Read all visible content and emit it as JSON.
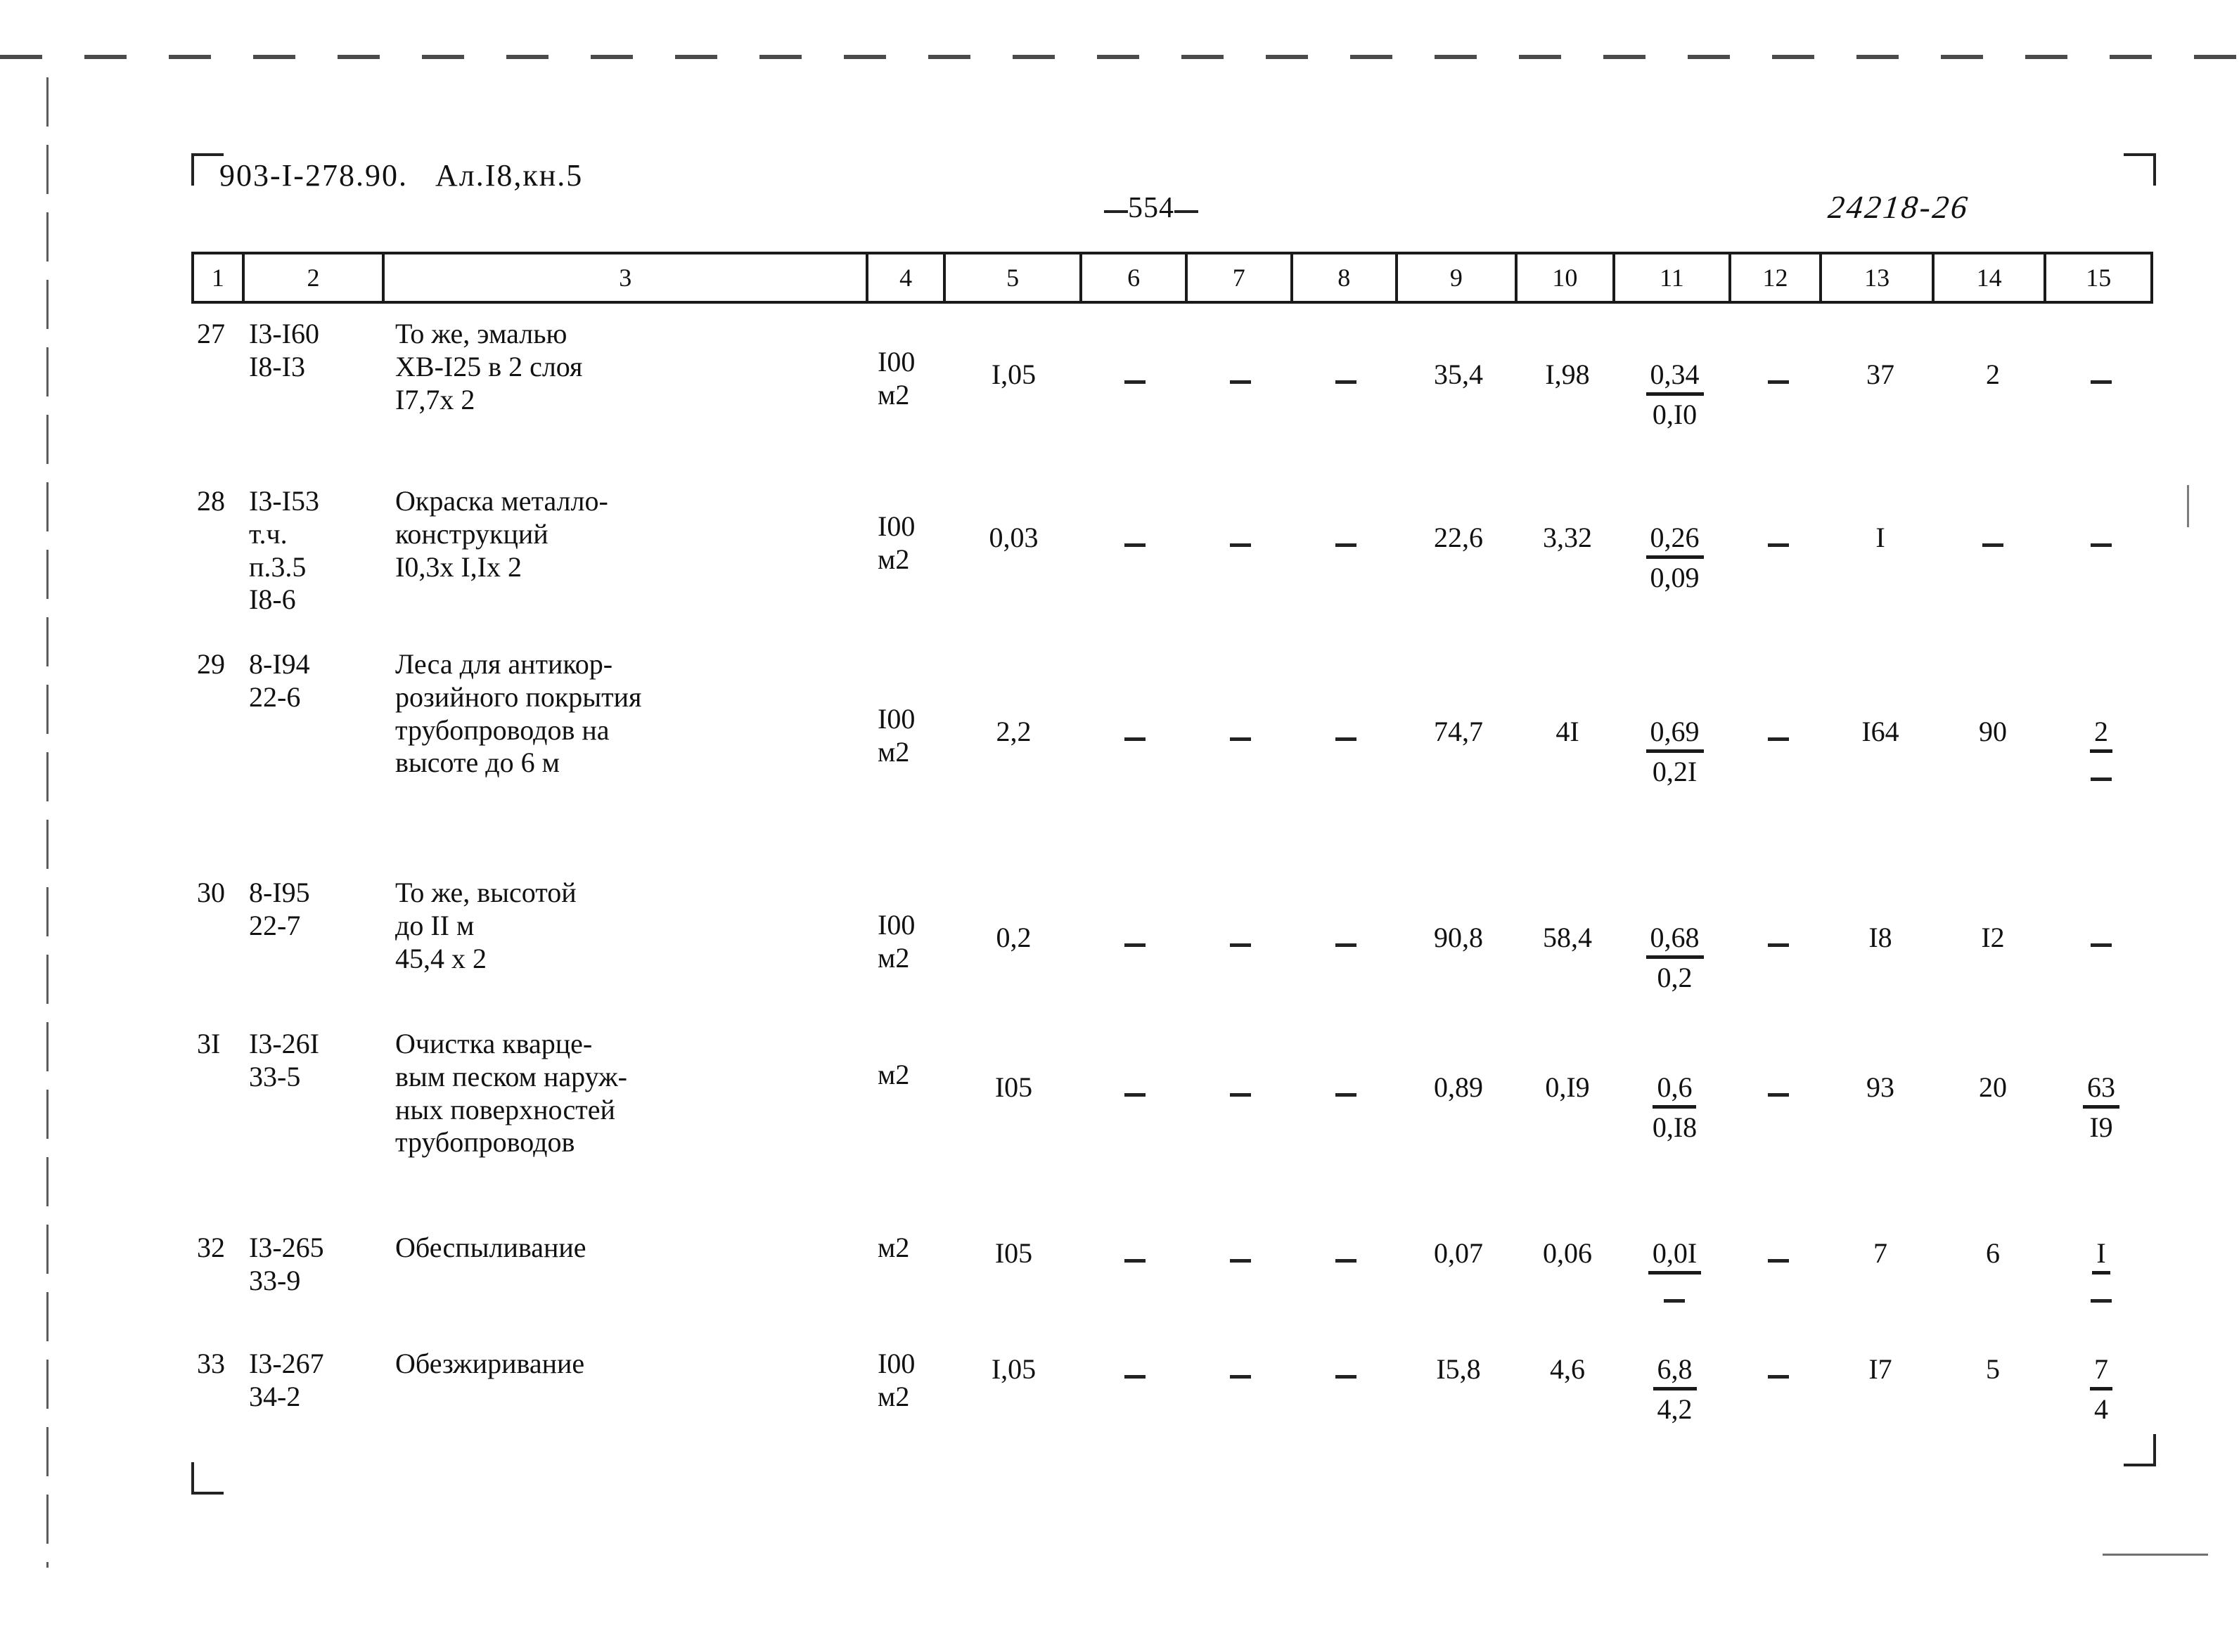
{
  "header": {
    "document_code": "903-I-278.90.   Ал.I8,кн.5",
    "page_number": "554",
    "archive_number": "24218-26"
  },
  "table": {
    "column_headers": [
      "1",
      "2",
      "3",
      "4",
      "5",
      "6",
      "7",
      "8",
      "9",
      "10",
      "11",
      "12",
      "13",
      "14",
      "15"
    ],
    "rows": [
      {
        "num": "27",
        "code": "I3-I60\nI8-I3",
        "description": "То же, эмалью\n  ХВ-I25 в 2 слоя\n     I7,7х 2",
        "unit": "I00\nм2",
        "c5": "I,05",
        "c6": "-",
        "c7": "-",
        "c8": "-",
        "c9": "35,4",
        "c10": "I,98",
        "c11_top": "0,34",
        "c11_bot": "0,I0",
        "c12": "-",
        "c13": "37",
        "c14": "2",
        "c15_top": "-",
        "c15_bot": ""
      },
      {
        "num": "28",
        "code": "I3-I53\nт.ч.\nп.3.5\nI8-6",
        "description": "Окраска металло-\nконструкций\nI0,3х I,Iх 2",
        "unit": "I00\nм2",
        "c5": "0,03",
        "c6": "-",
        "c7": "-",
        "c8": "-",
        "c9": "22,6",
        "c10": "3,32",
        "c11_top": "0,26",
        "c11_bot": "0,09",
        "c12": "-",
        "c13": "I",
        "c14": "-",
        "c15_top": "-",
        "c15_bot": ""
      },
      {
        "num": "29",
        "code": "8-I94\n22-6",
        "description": "Леса для антикор-\nрозийного покрытия\nтрубопроводов на\nвысоте до 6 м",
        "unit": "I00\nм2",
        "c5": "2,2",
        "c6": "-",
        "c7": "-",
        "c8": "-",
        "c9": "74,7",
        "c10": "4I",
        "c11_top": "0,69",
        "c11_bot": "0,2I",
        "c12": "-",
        "c13": "I64",
        "c14": "90",
        "c15_top": "2",
        "c15_bot": "-"
      },
      {
        "num": "30",
        "code": "8-I95\n22-7",
        "description": "То же, высотой\n    до II м\n  45,4 х 2",
        "unit": "I00\nм2",
        "c5": "0,2",
        "c6": "-",
        "c7": "-",
        "c8": "-",
        "c9": "90,8",
        "c10": "58,4",
        "c11_top": "0,68",
        "c11_bot": "0,2",
        "c12": "-",
        "c13": "I8",
        "c14": "I2",
        "c15_top": "-",
        "c15_bot": ""
      },
      {
        "num": "3I",
        "code": "I3-26I\n33-5",
        "description": "Очистка кварце-\nвым песком наруж-\nных поверхностей\nтрубопроводов",
        "unit": "м2",
        "c5": "I05",
        "c6": "-",
        "c7": "-",
        "c8": "-",
        "c9": "0,89",
        "c10": "0,I9",
        "c11_top": "0,6",
        "c11_bot": "0,I8",
        "c12": "-",
        "c13": "93",
        "c14": "20",
        "c15_top": "63",
        "c15_bot": "I9"
      },
      {
        "num": "32",
        "code": "I3-265\n33-9",
        "description": "Обеспыливание",
        "unit": "м2",
        "c5": "I05",
        "c6": "-",
        "c7": "-",
        "c8": "-",
        "c9": "0,07",
        "c10": "0,06",
        "c11_top": "0,0I",
        "c11_bot": "-",
        "c12": "-",
        "c13": "7",
        "c14": "6",
        "c15_top": "I",
        "c15_bot": "-"
      },
      {
        "num": "33",
        "code": "I3-267\n34-2",
        "description": "Обезжиривание",
        "unit": "I00\nм2",
        "c5": "I,05",
        "c6": "-",
        "c7": "-",
        "c8": "-",
        "c9": "I5,8",
        "c10": "4,6",
        "c11_top": "6,8",
        "c11_bot": "4,2",
        "c12": "-",
        "c13": "I7",
        "c14": "5",
        "c15_top": "7",
        "c15_bot": "4"
      }
    ]
  }
}
